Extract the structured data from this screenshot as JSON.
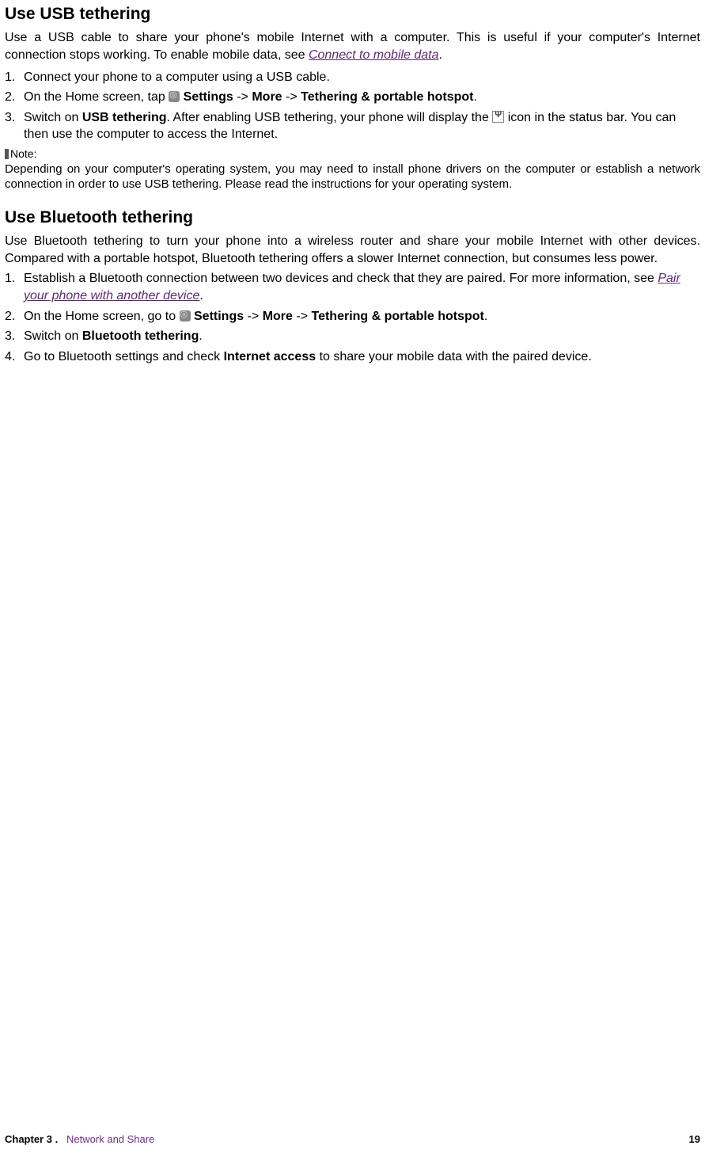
{
  "usb": {
    "heading": "Use USB tethering",
    "intro_a": "Use a USB cable to share your phone's mobile Internet with a computer. This is useful if your computer's Internet connection stops working. To enable mobile data, see ",
    "intro_link": "Connect to mobile data",
    "period": ".",
    "steps": [
      {
        "n": "1.",
        "text": "Connect your phone to a computer using a USB cable."
      },
      {
        "n": "2.",
        "pre": "On the Home screen, tap ",
        "s_label": "Settings",
        "a1": " -> ",
        "m_label": "More",
        "a2": " -> ",
        "t_label": "Tethering & portable hotspot",
        "post": "."
      },
      {
        "n": "3.",
        "pre": "Switch on ",
        "bold": "USB tethering",
        "mid": ". After enabling USB tethering, your phone will display the ",
        "post": " icon in the status bar. You can then use the computer to access the Internet."
      }
    ],
    "note_label": "Note:",
    "note_text": "Depending on your computer's operating system, you may need to install phone drivers on the computer or establish a network connection in order to use USB tethering. Please read the instructions for your operating system."
  },
  "bt": {
    "heading": "Use Bluetooth tethering",
    "intro": "Use Bluetooth tethering to turn your phone into a wireless router and share your mobile Internet with other devices. Compared with a portable hotspot, Bluetooth tethering offers a slower Internet connection, but consumes less power.",
    "steps": [
      {
        "n": "1.",
        "pre": "Establish a Bluetooth connection between two devices and check that they are paired. For more information, see ",
        "link": "Pair your phone with another device",
        "post": "."
      },
      {
        "n": "2.",
        "pre": "On the Home screen, go to ",
        "s_label": "Settings",
        "a1": " -> ",
        "m_label": "More",
        "a2": " -> ",
        "t_label": "Tethering & portable hotspot",
        "post": "."
      },
      {
        "n": "3.",
        "pre": "Switch on ",
        "bold": "Bluetooth tethering",
        "post": "."
      },
      {
        "n": "4.",
        "pre": "Go to Bluetooth settings and check ",
        "bold": "Internet access",
        "post": " to share your mobile data with the paired device."
      }
    ]
  },
  "footer": {
    "chapter": "Chapter 3 .",
    "title": "Network and Share",
    "page": "19"
  }
}
